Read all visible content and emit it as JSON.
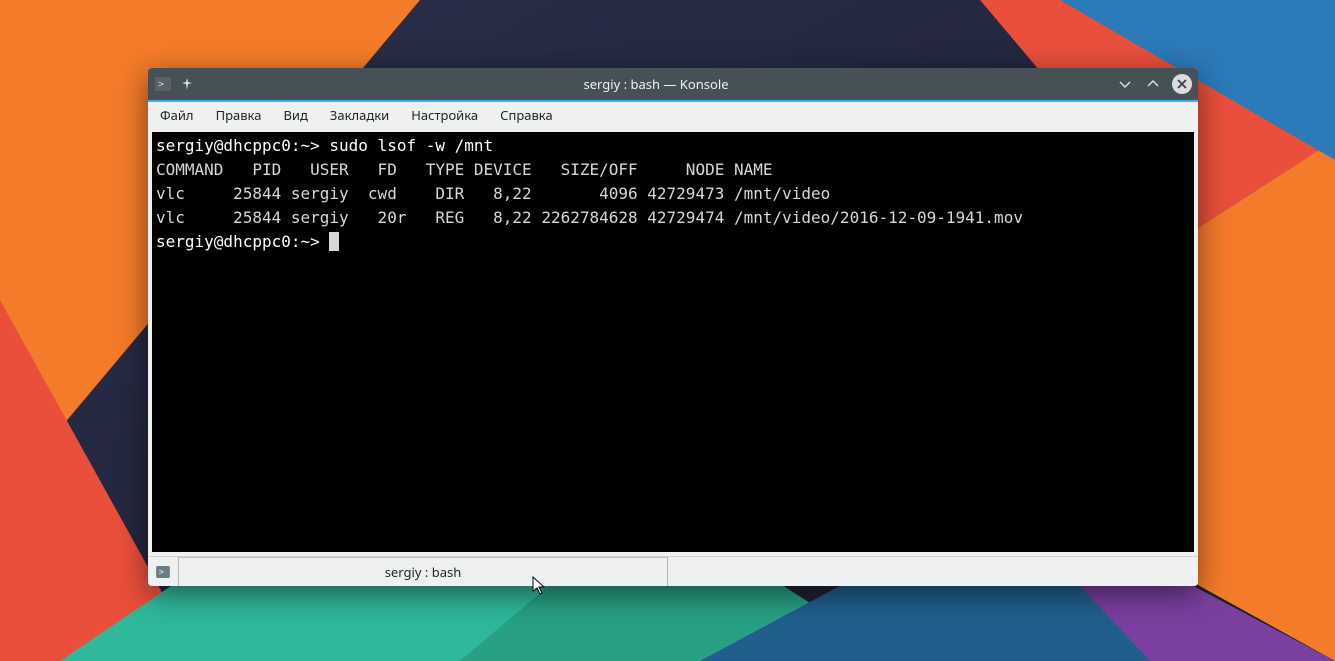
{
  "window": {
    "title": "sergiy : bash — Konsole"
  },
  "menu": {
    "file": "Файл",
    "edit": "Правка",
    "view": "Вид",
    "bookmarks": "Закладки",
    "settings": "Настройка",
    "help": "Справка"
  },
  "terminal": {
    "prompt1": "sergiy@dhcppc0:~>",
    "command1": "sudo lsof -w /mnt",
    "header": "COMMAND   PID   USER   FD   TYPE DEVICE   SIZE/OFF     NODE NAME",
    "row1": "vlc     25844 sergiy  cwd    DIR   8,22       4096 42729473 /mnt/video",
    "row2": "vlc     25844 sergiy   20r   REG   8,22 2262784628 42729474 /mnt/video/2016-12-09-1941.mov",
    "prompt2": "sergiy@dhcppc0:~>"
  },
  "tab": {
    "label": "sergiy : bash"
  }
}
